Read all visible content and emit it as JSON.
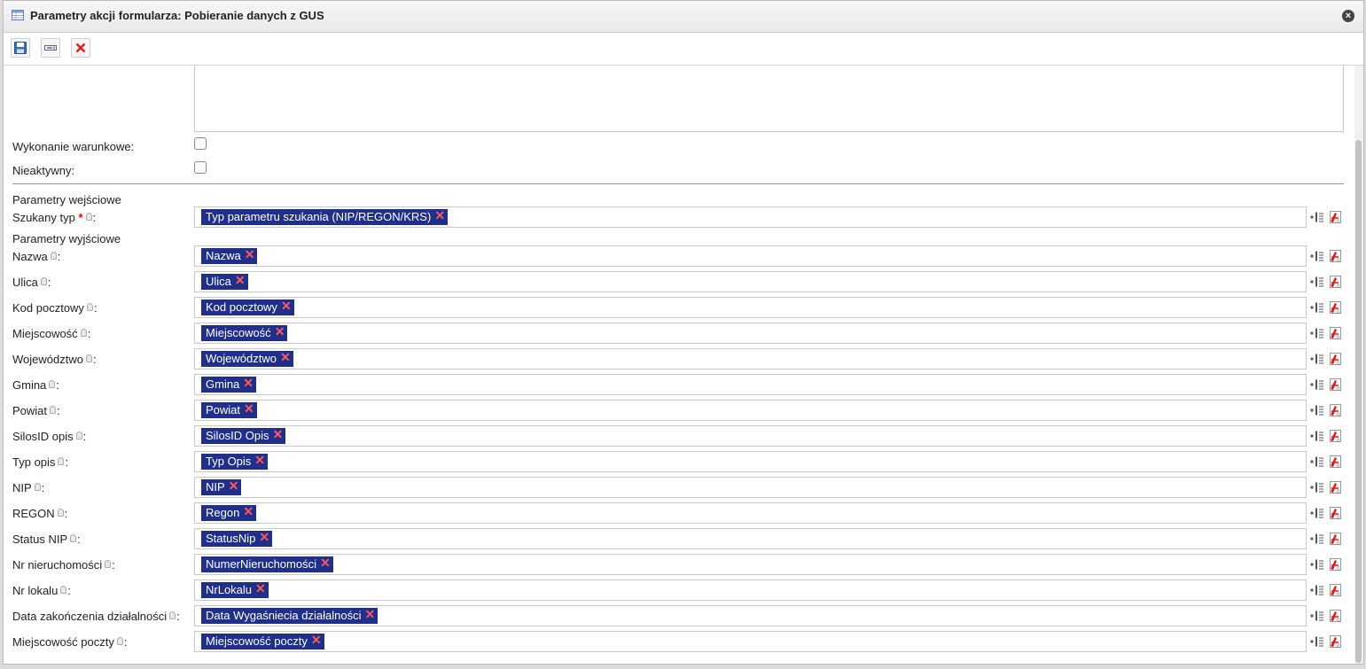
{
  "window": {
    "title": "Parametry akcji formularza: Pobieranie danych z GUS",
    "title_icon": "table-icon",
    "close_icon": "close-icon"
  },
  "toolbar": {
    "buttons": [
      {
        "icon": "save-icon"
      },
      {
        "icon": "text-field-icon"
      },
      {
        "icon": "delete-icon"
      }
    ]
  },
  "form": {
    "conditional_label": "Wykonanie warunkowe:",
    "inactive_label": "Nieaktywny:",
    "conditional_checked": false,
    "inactive_checked": false,
    "input_section_title": "Parametry wejściowe",
    "output_section_title": "Parametry wyjściowe",
    "colon": ":",
    "required_mark": "*",
    "input_params": [
      {
        "label": "Szukany typ",
        "value": "Typ parametru szukania (NIP/REGON/KRS)"
      }
    ],
    "output_params": [
      {
        "label": "Nazwa",
        "value": "Nazwa"
      },
      {
        "label": "Ulica",
        "value": "Ulica"
      },
      {
        "label": "Kod pocztowy",
        "value": "Kod pocztowy"
      },
      {
        "label": "Miejscowość",
        "value": "Miejscowość"
      },
      {
        "label": "Województwo",
        "value": "Województwo"
      },
      {
        "label": "Gmina",
        "value": "Gmina"
      },
      {
        "label": "Powiat",
        "value": "Powiat"
      },
      {
        "label": "SilosID opis",
        "value": "SilosID Opis"
      },
      {
        "label": "Typ opis",
        "value": "Typ Opis"
      },
      {
        "label": "NIP",
        "value": "NIP"
      },
      {
        "label": "REGON",
        "value": "Regon"
      },
      {
        "label": "Status NIP",
        "value": "StatusNip"
      },
      {
        "label": "Nr nieruchomości",
        "value": "NumerNieruchomości"
      },
      {
        "label": "Nr lokalu",
        "value": "NrLokalu"
      },
      {
        "label": "Data zakończenia działalności",
        "value": "Data Wygaśniecia działalności"
      },
      {
        "label": "Miejscowość poczty",
        "value": "Miejscowość poczty"
      }
    ],
    "tag_remove_symbol": "✕"
  },
  "colors": {
    "tag_background": "#1f2f8a",
    "tag_remove": "#ff5a5a",
    "separator": "#7f98b8"
  }
}
